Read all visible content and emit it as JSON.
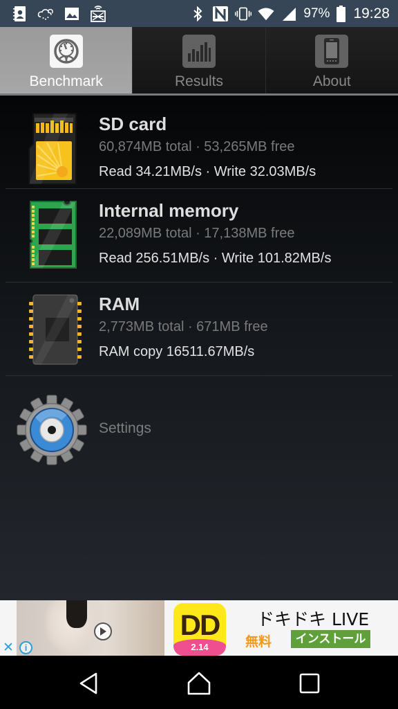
{
  "status_bar": {
    "left_icons": [
      "contacts-icon",
      "cloud-sync-icon",
      "gallery-icon",
      "screen-mirror-icon"
    ],
    "right_icons": [
      "bluetooth-icon",
      "nfc-icon",
      "vibrate-icon",
      "wifi-icon",
      "cell-signal-icon"
    ],
    "battery_percent": "97%",
    "time": "19:28"
  },
  "tabs": [
    {
      "label": "Benchmark",
      "icon": "speedometer-icon",
      "active": true
    },
    {
      "label": "Results",
      "icon": "bar-chart-icon",
      "active": false
    },
    {
      "label": "About",
      "icon": "phone-icon",
      "active": false
    }
  ],
  "storage_items": [
    {
      "title": "SD card",
      "icon": "sd-card-icon",
      "capacity": "60,874MB total · 53,265MB free",
      "speed": "Read 34.21MB/s · Write 32.03MB/s"
    },
    {
      "title": "Internal memory",
      "icon": "memory-chip-icon",
      "capacity": "22,089MB total · 17,138MB free",
      "speed": "Read 256.51MB/s · Write 101.82MB/s"
    },
    {
      "title": "RAM",
      "icon": "ram-chip-icon",
      "capacity": "2,773MB total · 671MB free",
      "speed": "RAM copy 16511.67MB/s"
    }
  ],
  "settings": {
    "label": "Settings",
    "icon": "gear-icon"
  },
  "ad": {
    "app_title": "ドキドキ LIVE",
    "price": "無料",
    "install_label": "インストール",
    "app_icon_text": "DD",
    "app_icon_version": "2.14",
    "close_glyph": "✕",
    "info_glyph": "i"
  },
  "nav_bar": {
    "buttons": [
      "back",
      "home",
      "recents"
    ]
  },
  "colors": {
    "status_bar_bg": "#364656",
    "active_tab_bg": "#a0a0a0",
    "sd_card_yellow": "#f7c21d",
    "memory_green": "#2ea44f",
    "settings_blue": "#3b8ad6",
    "install_green": "#5fa03a",
    "price_orange": "#f29a18"
  }
}
